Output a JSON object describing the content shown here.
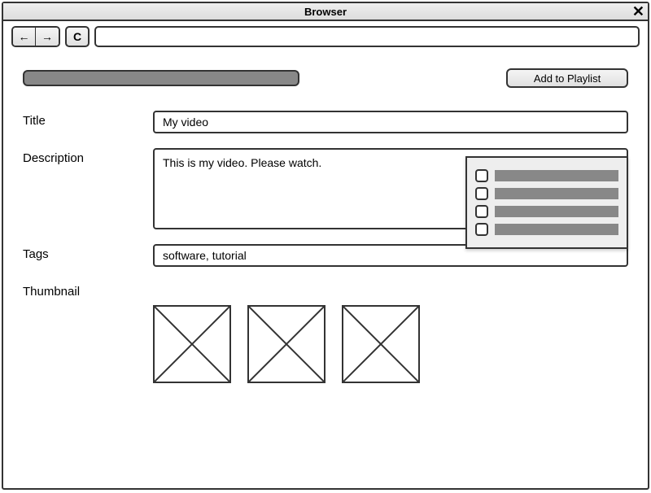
{
  "window": {
    "title": "Browser"
  },
  "toolbar": {
    "back_glyph": "←",
    "forward_glyph": "→",
    "reload_glyph": "C",
    "url": ""
  },
  "buttons": {
    "add_to_playlist": "Add to Playlist"
  },
  "labels": {
    "title": "Title",
    "description": "Description",
    "tags": "Tags",
    "thumbnail": "Thumbnail"
  },
  "form": {
    "title": "My video",
    "description": "This is my video. Please watch.",
    "tags": "software, tutorial"
  },
  "playlist_popup": {
    "items": [
      {
        "checked": false
      },
      {
        "checked": false
      },
      {
        "checked": false
      },
      {
        "checked": false
      }
    ]
  },
  "thumbnails": [
    {},
    {},
    {}
  ]
}
